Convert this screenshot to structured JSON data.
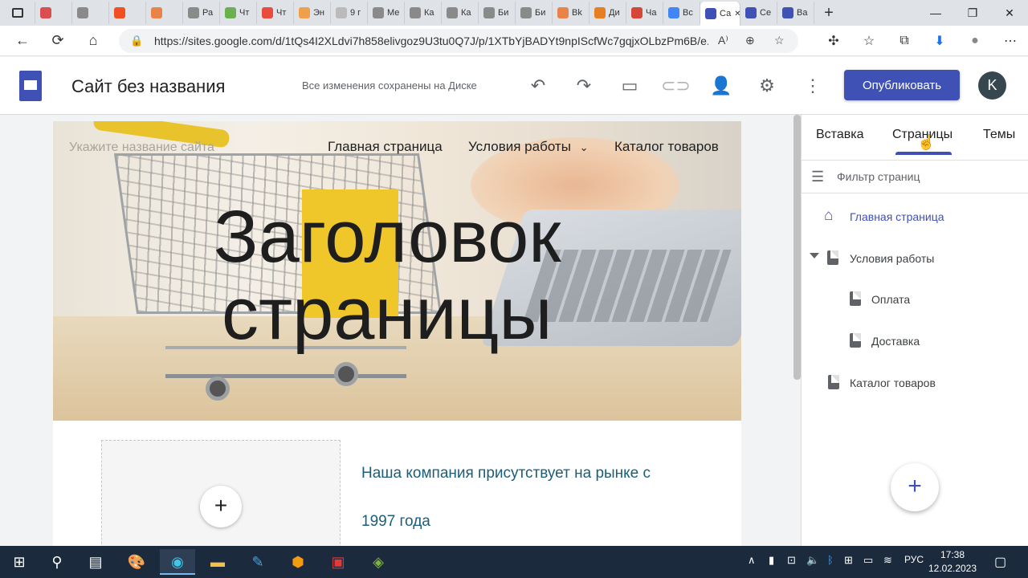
{
  "browser": {
    "tabs": [
      {
        "label": "",
        "color": "#d94f4f"
      },
      {
        "label": "",
        "color": "#8a8a8a"
      },
      {
        "label": "",
        "color": "#f25022"
      },
      {
        "label": "",
        "color": "#e8834a"
      },
      {
        "label": "Ра",
        "color": "#8a8a8a"
      },
      {
        "label": "Чт",
        "color": "#6ab04c"
      },
      {
        "label": "Чт",
        "color": "#e74c3c"
      },
      {
        "label": "Эн",
        "color": "#f0a04b"
      },
      {
        "label": "9 г",
        "color": "#bbbbbb"
      },
      {
        "label": "Ме",
        "color": "#8a8a8a"
      },
      {
        "label": "Ка",
        "color": "#8a8a8a"
      },
      {
        "label": "Ка",
        "color": "#8a8a8a"
      },
      {
        "label": "Би",
        "color": "#8a8a8a"
      },
      {
        "label": "Би",
        "color": "#8a8a8a"
      },
      {
        "label": "Вk",
        "color": "#e8834a"
      },
      {
        "label": "Ди",
        "color": "#e67e22"
      },
      {
        "label": "Ча",
        "color": "#d44638"
      },
      {
        "label": "Вс",
        "color": "#4285f4"
      },
      {
        "label": "Са",
        "color": "#3f51b5",
        "active": true
      },
      {
        "label": "Се",
        "color": "#3f51b5"
      },
      {
        "label": "Ва",
        "color": "#3f51b5"
      }
    ],
    "new_tab_icon": "+",
    "window_buttons": [
      "—",
      "❐",
      "✕"
    ],
    "url": "https://sites.google.com/d/1tQs4I2XLdvi7h858elivgoz9U3tu0Q7J/p/1XTbYjBADYt9npIScfWc7gqjxOLbzPm6B/e...",
    "reader_icon": "A⁾"
  },
  "app": {
    "site_title": "Сайт без названия",
    "save_status": "Все изменения сохранены на Диске",
    "publish_label": "Опубликовать",
    "avatar_letter": "K",
    "brand_color": "#3f51b5"
  },
  "hero": {
    "site_name_placeholder": "Укажите название сайта",
    "nav": [
      "Главная страница",
      "Условия работы",
      "Каталог товаров"
    ],
    "title_line1": "Заголовок",
    "title_line2": "страницы"
  },
  "content": {
    "text_line1": "Наша компания присутствует на рынке с",
    "text_line2": "1997 года",
    "add_icon": "+"
  },
  "panel": {
    "tabs": [
      "Вставка",
      "Страницы",
      "Темы"
    ],
    "active_tab": "Страницы",
    "filter_label": "Фильтр страниц",
    "pages": [
      {
        "label": "Главная страница",
        "level": 0,
        "home": true
      },
      {
        "label": "Условия работы",
        "level": 0,
        "expanded": true
      },
      {
        "label": "Оплата",
        "level": 1
      },
      {
        "label": "Доставка",
        "level": 1
      },
      {
        "label": "Каталог товаров",
        "level": 0
      }
    ],
    "fab_icon": "+"
  },
  "taskbar": {
    "language": "РУС",
    "time": "17:38",
    "date": "12.02.2023"
  }
}
